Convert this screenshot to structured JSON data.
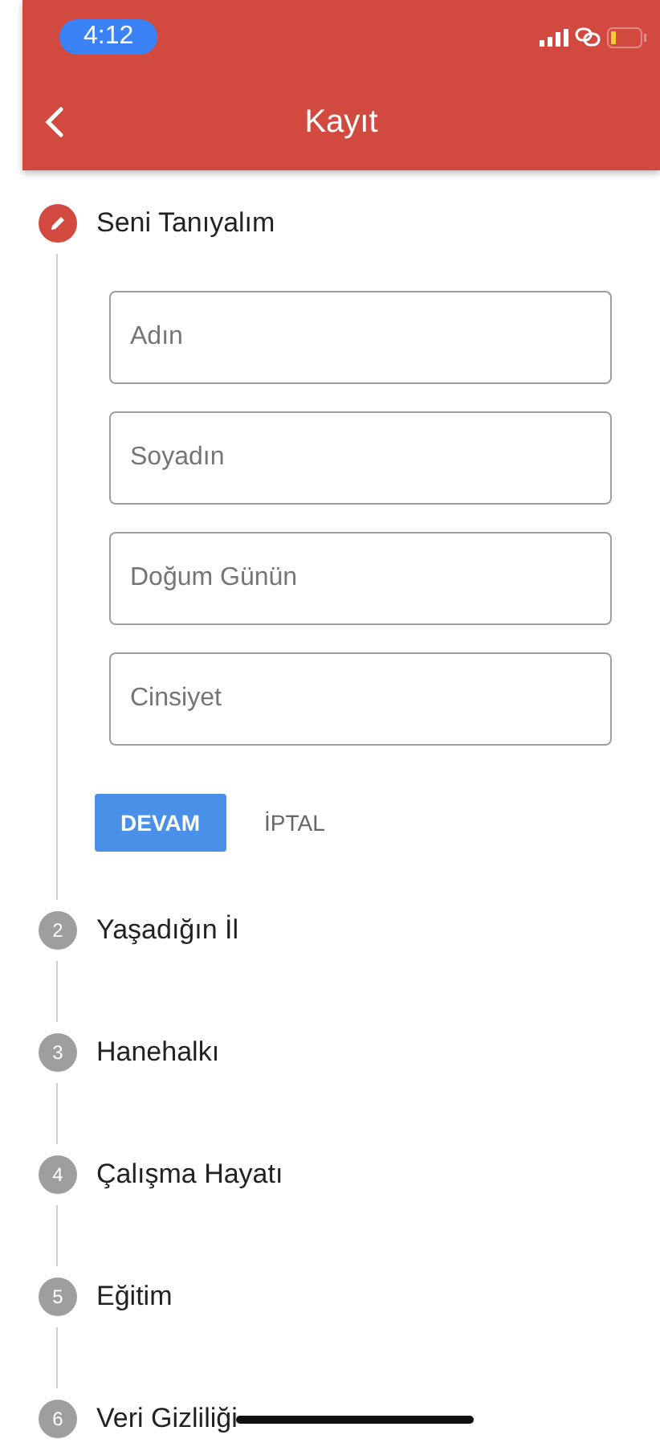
{
  "status_bar": {
    "time": "4:12"
  },
  "app_bar": {
    "title": "Kayıt"
  },
  "steps": [
    {
      "title": "Seni Tanıyalım",
      "active": true,
      "fields": [
        {
          "placeholder": "Adın"
        },
        {
          "placeholder": "Soyadın"
        },
        {
          "placeholder": "Doğum Günün"
        },
        {
          "placeholder": "Cinsiyet"
        }
      ],
      "buttons": [
        {
          "label": "DEVAM",
          "kind": "primary"
        },
        {
          "label": "İPTAL",
          "kind": "text"
        }
      ]
    },
    {
      "number": "2",
      "title": "Yaşadığın İl",
      "active": false
    },
    {
      "number": "3",
      "title": "Hanehalkı",
      "active": false
    },
    {
      "number": "4",
      "title": "Çalışma Hayatı",
      "active": false
    },
    {
      "number": "5",
      "title": "Eğitim",
      "active": false
    },
    {
      "number": "6",
      "title": "Veri Gizliliği",
      "active": false
    }
  ]
}
